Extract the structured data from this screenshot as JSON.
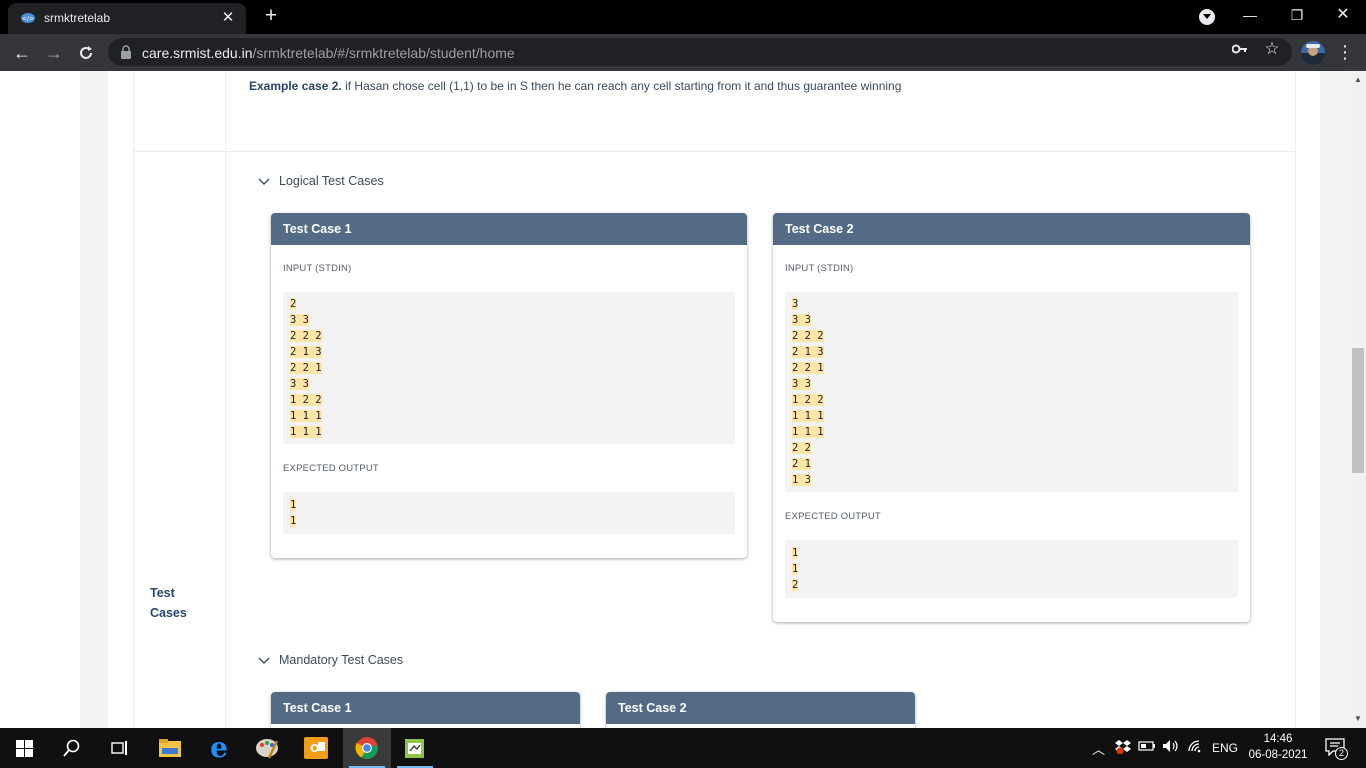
{
  "browser": {
    "tab_title": "srmktretelab",
    "url_host": "care.srmist.edu.in",
    "url_path": "/srmktretelab/#/srmktretelab/student/home"
  },
  "page": {
    "example_label": "Example case 2.",
    "example_text": " if Hasan chose cell (1,1) to be in S then he can reach any cell starting from it and thus guarantee winning",
    "side_label_line1": "Test",
    "side_label_line2": "Cases",
    "logical_title": "Logical Test Cases",
    "mandatory_title": "Mandatory Test Cases",
    "input_label": "INPUT (STDIN)",
    "output_label": "EXPECTED OUTPUT",
    "logical_cases": [
      {
        "title": "Test Case 1",
        "input": [
          "2",
          "3 3",
          "2 2 2",
          "2 1 3",
          "2 2 1",
          "3 3",
          "1 2 2",
          "1 1 1",
          "1 1 1"
        ],
        "output": [
          "1",
          "1"
        ]
      },
      {
        "title": "Test Case 2",
        "input": [
          "3",
          "3 3",
          "2 2 2",
          "2 1 3",
          "2 2 1",
          "3 3",
          "1 2 2",
          "1 1 1",
          "1 1 1",
          "2 2",
          "2 1",
          "1 3"
        ],
        "output": [
          "1",
          "1",
          "2"
        ]
      }
    ],
    "mandatory_cases": [
      {
        "title": "Test Case 1"
      },
      {
        "title": "Test Case 2"
      }
    ]
  },
  "taskbar": {
    "language": "ENG",
    "time": "14:46",
    "date": "06-08-2021",
    "notification_count": "2"
  },
  "colors": {
    "case_header": "#546b85",
    "highlight": "#fbe6a8",
    "chrome_dark": "#202124"
  }
}
